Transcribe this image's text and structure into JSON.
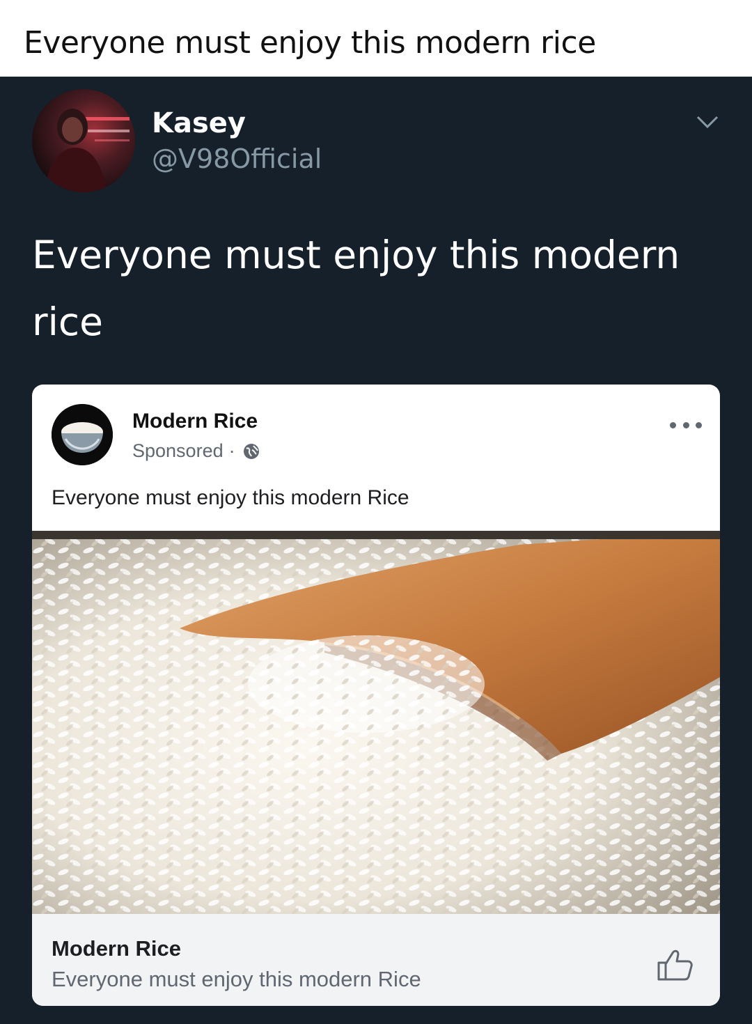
{
  "caption": {
    "text": "Everyone must enjoy this modern rice"
  },
  "tweet": {
    "user": {
      "name": "Kasey",
      "handle": "@V98Official",
      "avatar_icon": "profile-photo"
    },
    "menu_icon": "chevron-down-icon",
    "text": "Everyone must enjoy this modern rice",
    "background_color": "#15202b"
  },
  "ad": {
    "page_name": "Modern Rice",
    "sponsored_label": "Sponsored",
    "separator": "·",
    "audience_icon": "globe-icon",
    "more_icon": "more-options-icon",
    "post_text": "Everyone must enjoy this modern Rice",
    "image_icon": "rice-photo",
    "footer": {
      "title": "Modern Rice",
      "subtitle": "Everyone must enjoy this modern Rice",
      "like_icon": "thumbs-up-icon"
    }
  }
}
